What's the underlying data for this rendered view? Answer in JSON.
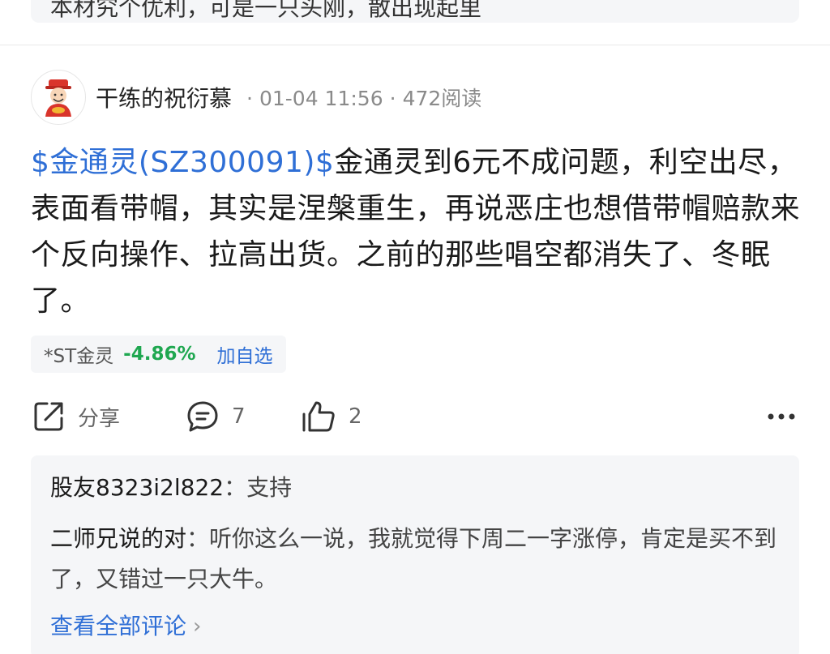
{
  "previous_post": {
    "text": "本材究个优利，可是一只头刚，散出现起里"
  },
  "post": {
    "author": "干练的祝衍慕",
    "date": "01-04 11:56",
    "reads": "472阅读",
    "stock_tag": "$金通灵(SZ300091)$",
    "content": "金通灵到6元不成问题，利空出尽，表面看带帽，其实是涅槃重生，再说恶庄也想借带帽赔款来个反向操作、拉高出货。之前的那些唱空都消失了、冬眠了。"
  },
  "stock_chip": {
    "name": "*ST金灵",
    "change": "-4.86%",
    "add_label": "加自选"
  },
  "actions": {
    "share_label": "分享",
    "comment_count": "7",
    "like_count": "2",
    "share_icon": "share-icon",
    "comment_icon": "comment-icon",
    "like_icon": "thumbs-up-icon",
    "more_icon": "more-icon"
  },
  "comments": [
    {
      "user": "股友8323i2l822",
      "sep": "：",
      "text": "支持"
    },
    {
      "user": "二师兄说的对",
      "sep": "：",
      "text": "听你这么一说，我就觉得下周二一字涨停，肯定是买不到了，又错过一只大牛。"
    }
  ],
  "view_all_label": "查看全部评论",
  "colors": {
    "link": "#2f6fd6",
    "down": "#1fa750",
    "panel": "#f5f6f8"
  }
}
